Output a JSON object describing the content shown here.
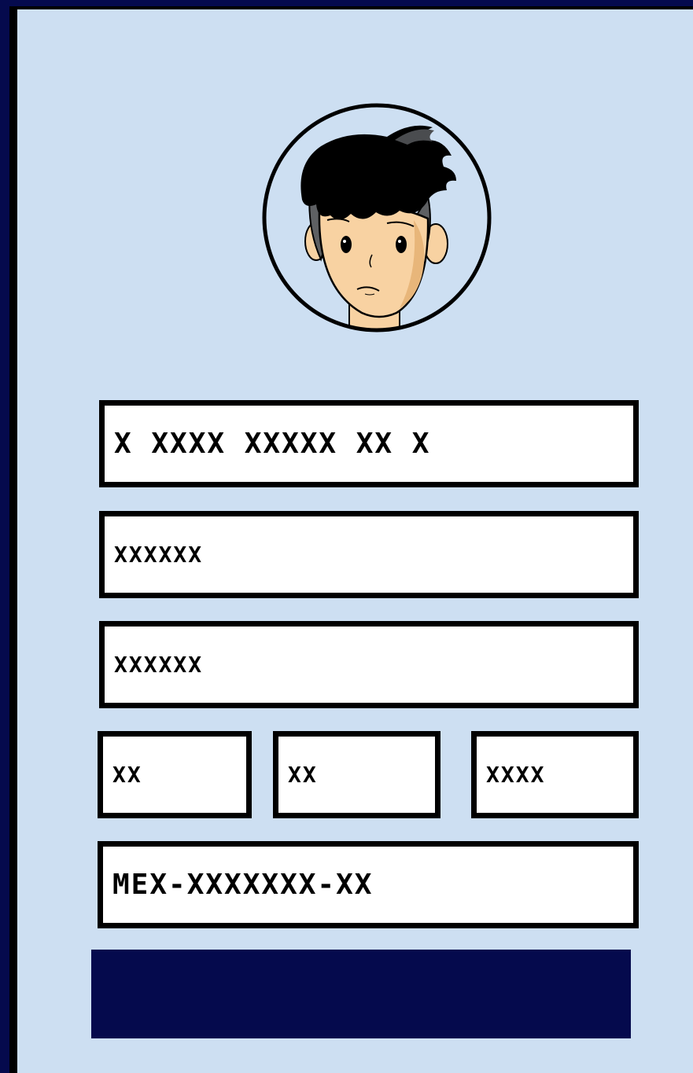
{
  "form": {
    "full_name": {
      "value": "X XXXX XXXXX XX X"
    },
    "field_2": {
      "value": "XXXXXX"
    },
    "field_3": {
      "value": "XXXXXX"
    },
    "date": {
      "day": "XX",
      "month": "XX",
      "year": "XXXX"
    },
    "id_code": {
      "value": "MEX-XXXXXXX-XX"
    },
    "submit_label": ""
  },
  "avatar": {
    "icon": "person-avatar-icon"
  },
  "colors": {
    "background": "#050a4d",
    "card": "#cddff2",
    "field": "#ffffff",
    "border": "#000000",
    "button": "#050a4d",
    "skin": "#f8d2a2"
  }
}
